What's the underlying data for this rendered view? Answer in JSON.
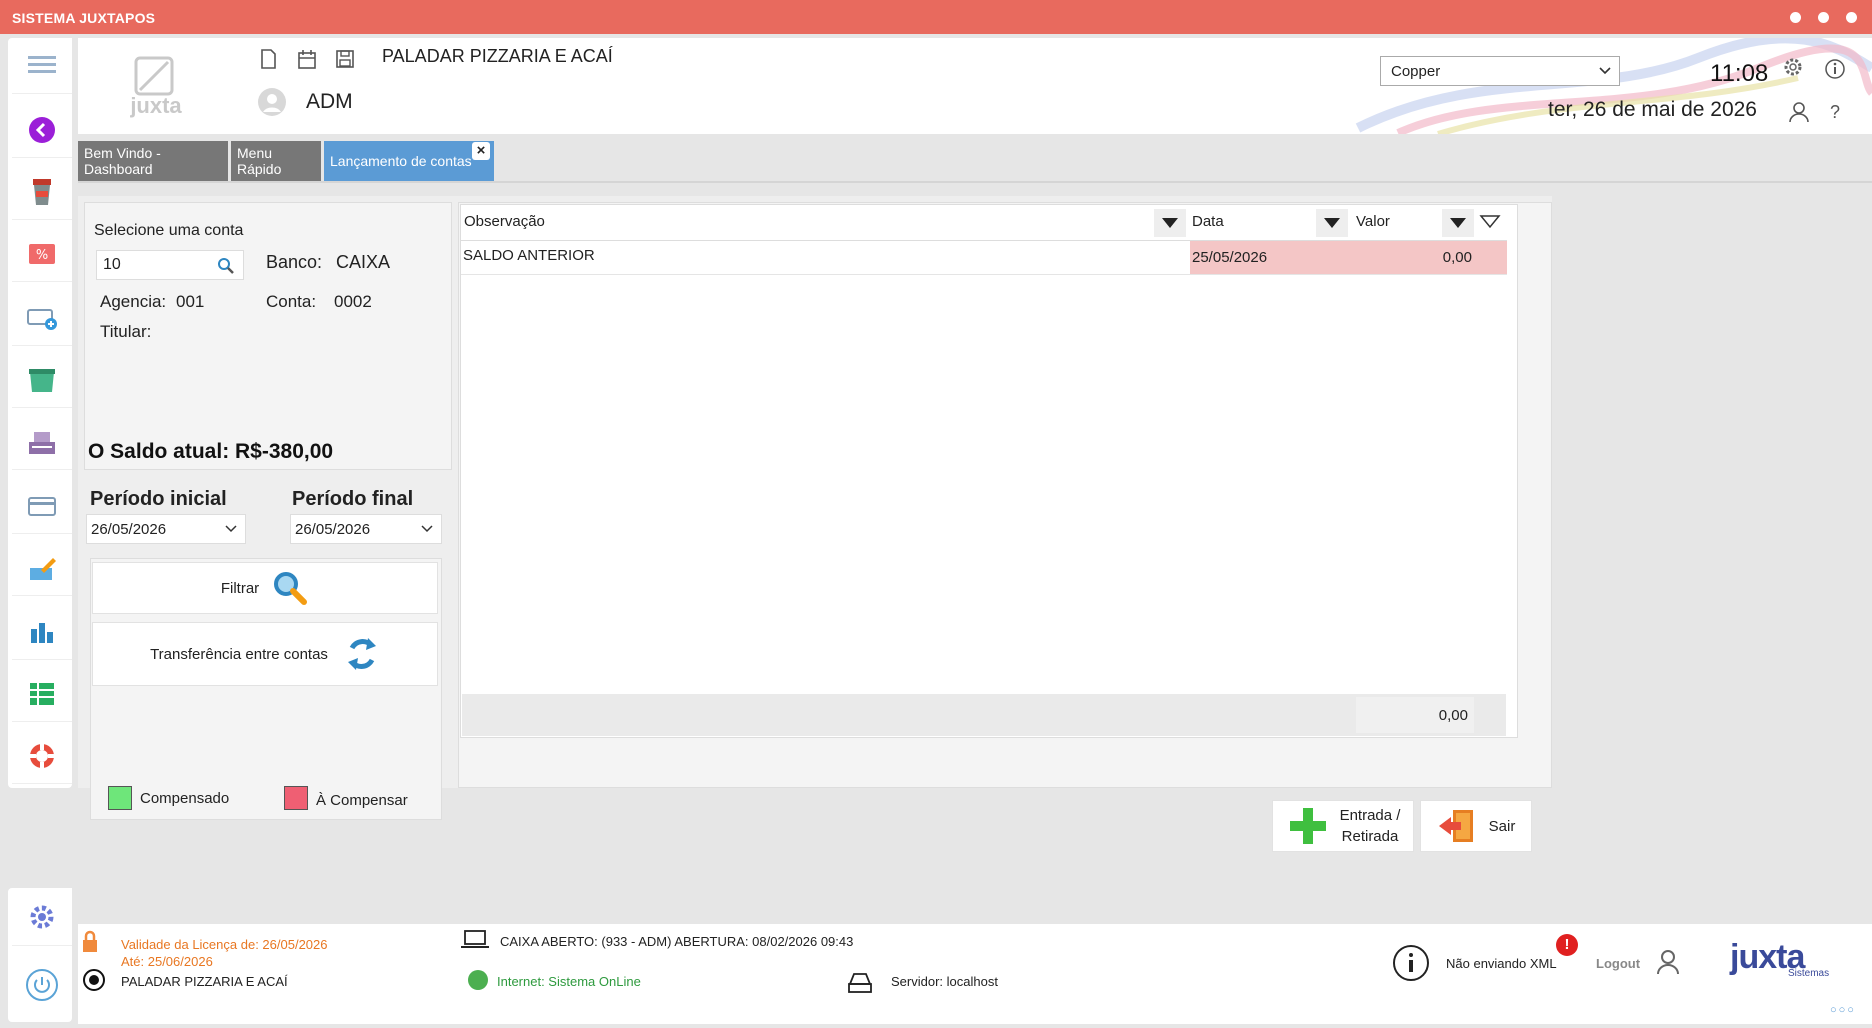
{
  "window": {
    "title": "SISTEMA JUXTAPOS"
  },
  "header": {
    "company": "PALADAR PIZZARIA E ACAÍ",
    "user": "ADM",
    "logo_text": "juxta",
    "theme_select": "Copper",
    "time": "11:08",
    "date": "ter, 26 de mai de 2026"
  },
  "tabs": [
    {
      "label": "Bem Vindo - Dashboard"
    },
    {
      "label": "Menu Rápido"
    },
    {
      "label": "Lançamento de contas"
    }
  ],
  "account": {
    "select_label": "Selecione uma conta",
    "account_input": "10",
    "bank_label": "Banco:",
    "bank_value": "CAIXA",
    "agency_label": "Agencia:",
    "agency_value": "001",
    "conta_label": "Conta:",
    "conta_value": "0002",
    "titular_label": "Titular:",
    "balance": "O Saldo atual: R$-380,00"
  },
  "period": {
    "start_label": "Período inicial",
    "start_value": "26/05/2026",
    "end_label": "Período final",
    "end_value": "26/05/2026"
  },
  "actions": {
    "filter": "Filtrar",
    "transfer": "Transferência entre contas",
    "entry_line1": "Entrada /",
    "entry_line2": "Retirada",
    "exit": "Sair"
  },
  "legend": {
    "compensated": "Compensado",
    "to_compensate": "À Compensar",
    "compensated_color": "#6ee67a",
    "to_compensate_color": "#ef5f73"
  },
  "grid": {
    "columns": [
      "Observação",
      "Data",
      "Valor"
    ],
    "rows": [
      {
        "obs": "SALDO ANTERIOR",
        "date": "25/05/2026",
        "value": "0,00"
      }
    ],
    "total": "0,00"
  },
  "status": {
    "license_line1": "Validade da Licença de: 26/05/2026",
    "license_line2": "Até: 25/06/2026",
    "company": "PALADAR PIZZARIA E ACAÍ",
    "caixa": "CAIXA ABERTO: (933 - ADM) ABERTURA: 08/02/2026 09:43",
    "internet": "Internet: Sistema OnLine",
    "server": "Servidor: localhost",
    "xml": "Não enviando XML",
    "logout": "Logout",
    "brand": "juxta",
    "brand_sub": "Sistemas"
  },
  "colors": {
    "titlebar": "#e86a5e",
    "tab_inactive": "#777777",
    "tab_active": "#5b9bd5",
    "row_pending": "#f4c6c6",
    "license_text": "#e87722",
    "online_green": "#4caf50"
  }
}
